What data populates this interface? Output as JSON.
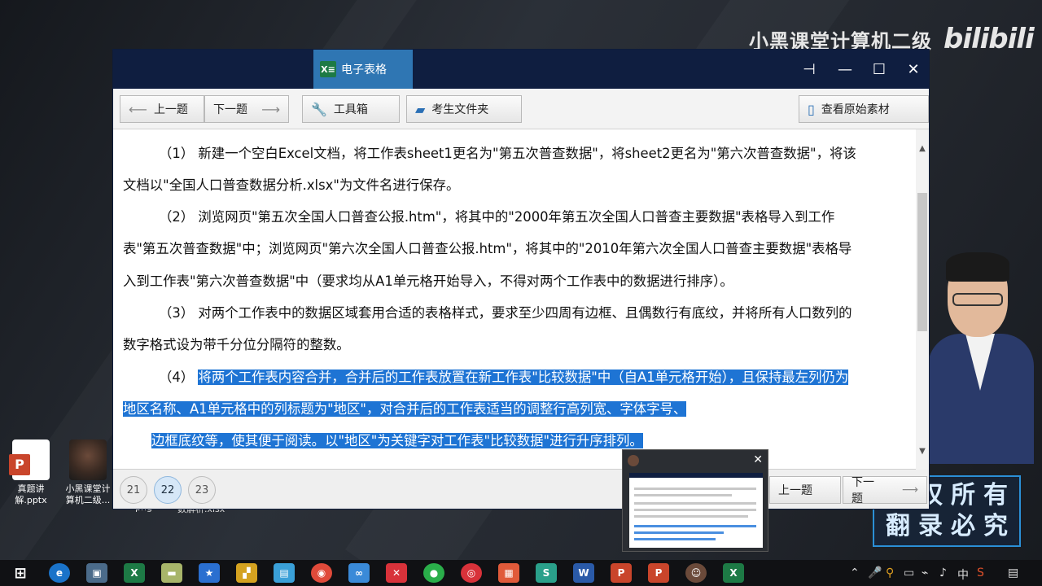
{
  "watermark": {
    "channel": "小黑课堂计算机二级",
    "site_logo": "bilibili"
  },
  "overlay_stamp": {
    "line1": "版权所有",
    "line2": "翻录必究"
  },
  "desktop_icons": [
    {
      "label": "真题讲解.pptx",
      "icon": "powerpoint-file-icon"
    },
    {
      "label": "小黑课堂计算机二级...",
      "icon": "avatar-shortcut-icon"
    }
  ],
  "partial_labels": {
    "png": "png",
    "xlsx": "数解析.xlsx"
  },
  "window": {
    "tab_label": "电子表格",
    "tab_icon": "X≡",
    "controls": {
      "pin": "⊣",
      "minimize": "—",
      "maximize": "☐",
      "close": "✕"
    }
  },
  "toolbar": {
    "prev_label": "上一题",
    "next_label": "下一题",
    "toolbox_label": "工具箱",
    "folder_label": "考生文件夹",
    "view_source_label": "查看原始素材"
  },
  "content": {
    "lines": [
      "（1） 新建一个空白Excel文档，将工作表sheet1更名为\"第五次普查数据\"，将sheet2更名为\"第六次普查数据\"，将该",
      "文档以\"全国人口普查数据分析.xlsx\"为文件名进行保存。",
      "（2） 浏览网页\"第五次全国人口普查公报.htm\"，将其中的\"2000年第五次全国人口普查主要数据\"表格导入到工作",
      "表\"第五次普查数据\"中；浏览网页\"第六次全国人口普查公报.htm\"，将其中的\"2010年第六次全国人口普查主要数据\"表格导",
      "入到工作表\"第六次普查数据\"中（要求均从A1单元格开始导入，不得对两个工作表中的数据进行排序）。",
      "（3） 对两个工作表中的数据区域套用合适的表格样式，要求至少四周有边框、且偶数行有底纹，并将所有人口数列的",
      "数字格式设为带千分位分隔符的整数。"
    ],
    "item4_number": "（4）",
    "item4_line1": "将两个工作表内容合并，合并后的工作表放置在新工作表\"比较数据\"中（自A1单元格开始），且保持最左列仍为",
    "item4_line2": "地区名称、A1单元格中的列标题为\"地区\"，对合并后的工作表适当的调整行高列宽、字体字号、",
    "item4_line3": "边框底纹等，使其便于阅读。以\"地区\"为关键字对工作表\"比较数据\"进行升序排列。"
  },
  "footer": {
    "pages": [
      "21",
      "22",
      "23"
    ],
    "active_page": "22",
    "prev_label": "上一题",
    "next_label": "下一题"
  },
  "preview": {
    "close": "✕"
  },
  "tray": {
    "ime": "中"
  }
}
